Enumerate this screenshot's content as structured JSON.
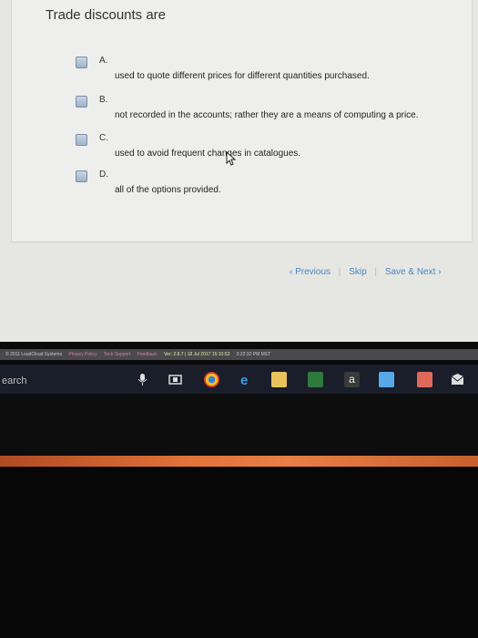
{
  "question": {
    "title": "Trade discounts are",
    "options": [
      {
        "letter": "A.",
        "text": "used to quote different prices for different quantities purchased."
      },
      {
        "letter": "B.",
        "text": "not recorded in the accounts; rather they are a means of computing a price."
      },
      {
        "letter": "C.",
        "text": "used to avoid frequent changes in catalogues."
      },
      {
        "letter": "D.",
        "text": "all of the options provided."
      }
    ]
  },
  "nav": {
    "previous": "‹ Previous",
    "skip": "Skip",
    "save_next": "Save & Next ›",
    "separator": "|"
  },
  "footer": {
    "copyright": "© 2011 LoudCloud Systems",
    "privacy": "Privacy Policy",
    "tech_support": "Tech Support",
    "feedback": "Feedback",
    "version": "Ver: 2.8.7 | 18 Jul 2017 15:10:53",
    "time": "3:22:32 PM MST"
  },
  "taskbar": {
    "search": "earch"
  },
  "colors": {
    "link": "#4a86c5",
    "taskbar": "#1a1d2a"
  }
}
